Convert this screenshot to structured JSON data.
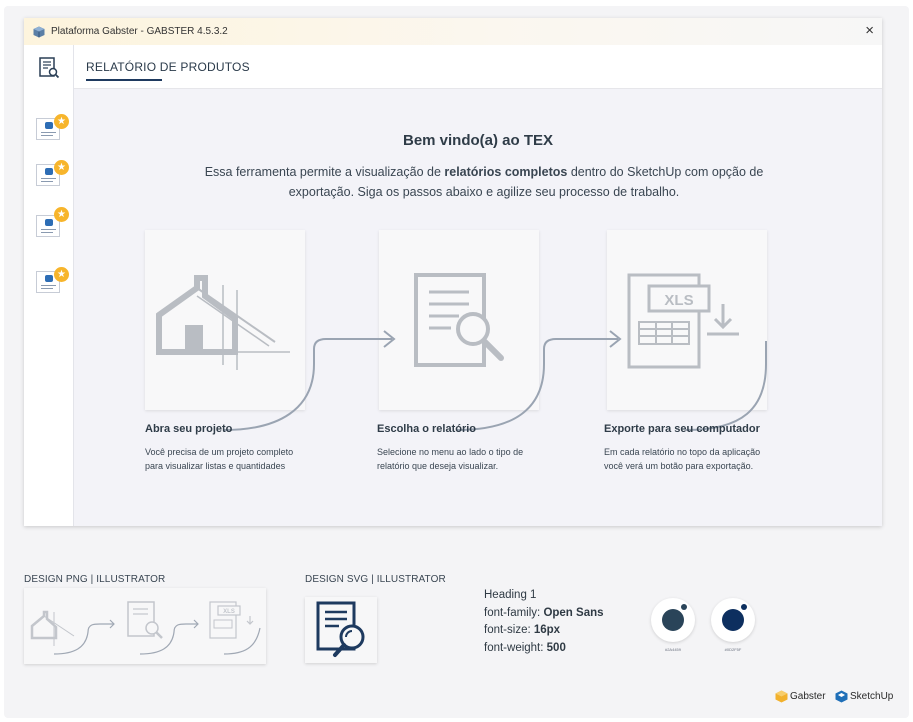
{
  "window": {
    "title": "Plataforma Gabster - GABSTER 4.5.3.2",
    "close_icon": "×"
  },
  "header": {
    "title": "RELATÓRIO DE PRODUTOS"
  },
  "sidebar": {
    "items": [
      {
        "icon": "report-doc-icon",
        "badge": "★"
      },
      {
        "icon": "report-doc-icon",
        "badge": "★"
      },
      {
        "icon": "report-doc-icon",
        "badge": "★"
      },
      {
        "icon": "report-doc-icon",
        "badge": "★"
      }
    ]
  },
  "main": {
    "welcome": "Bem vindo(a) ao TEX",
    "desc_part1": "Essa ferramenta permite a visualização de ",
    "desc_bold": "relatórios completos",
    "desc_part2": " dentro do SketchUp com opção de exportação. Siga os passos abaixo e agilize seu processo de trabalho.",
    "steps": [
      {
        "title": "Abra seu projeto",
        "line1": "Você precisa de um projeto completo",
        "line2": "para visualizar listas e quantidades"
      },
      {
        "title": "Escolha o relatório",
        "line1": "Selecione no menu ao lado o tipo de",
        "line2": "relatório que deseja visualizar."
      },
      {
        "title": "Exporte para seu computador",
        "line1": "Em cada relatório no topo da aplicação",
        "line2": "você verá um botão para exportação."
      }
    ],
    "xls_label": "XLS"
  },
  "design": {
    "png_label": "DESIGN PNG | ILLUSTRATOR",
    "svg_label": "DESIGN SVG | ILLUSTRATOR",
    "typography": {
      "heading": "Heading 1",
      "family_key": "font-family: ",
      "family_value": "Open Sans",
      "size_key": "font-size: ",
      "size_value": "16px",
      "weight_key": "font-weight: ",
      "weight_value": "500"
    },
    "swatches": [
      {
        "color": "#2a4459",
        "label": "#2A4459"
      },
      {
        "color": "#0d2f5f",
        "label": "#0D2F5F"
      }
    ]
  },
  "brands": {
    "gabster": "Gabster",
    "sketchup": "SketchUp"
  },
  "colors": {
    "accent": "#1e3a5f",
    "star": "#f7b52c",
    "illustration": "#b9bdc3"
  }
}
